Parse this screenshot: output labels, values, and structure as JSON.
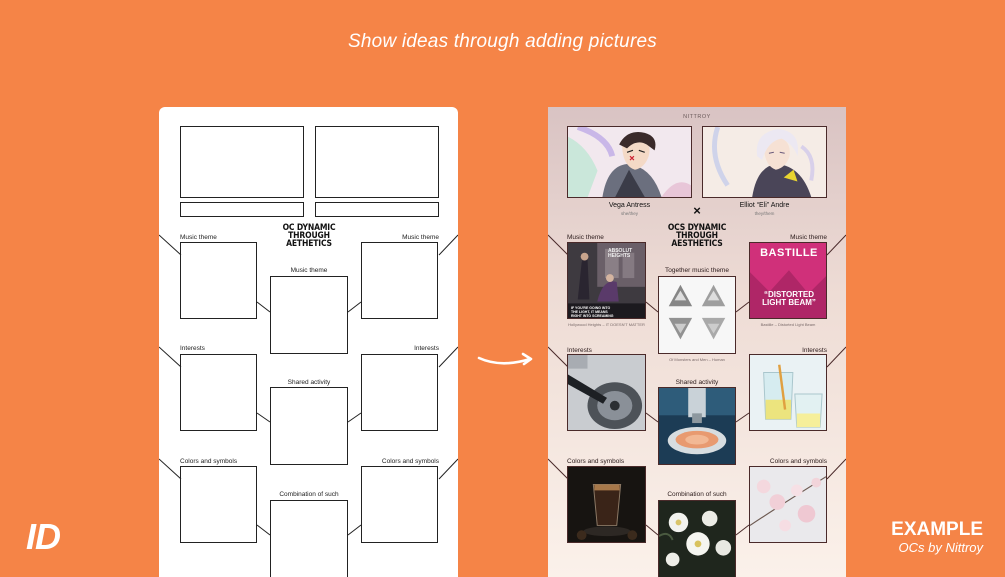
{
  "header": {
    "title": "Show ideas through adding pictures"
  },
  "logo": {
    "text": "ID"
  },
  "example": {
    "title": "EXAMPLE",
    "subtitle": "OCs by Nittroy"
  },
  "template": {
    "title_lines": [
      "OC DYNAMIC",
      "THROUGH",
      "AETHETICS"
    ],
    "music_left": "Music theme",
    "music_right": "Music theme",
    "music_center": "Music theme",
    "interests_left": "Interests",
    "interests_right": "Interests",
    "shared_activity": "Shared activity",
    "colors_left": "Colors and symbols",
    "colors_right": "Colors and symbols",
    "combination": "Combination of such"
  },
  "filled": {
    "author": "NITTROY",
    "char1": {
      "name": "Vega Antress",
      "pronouns": "she/they"
    },
    "char2": {
      "name": "Elliot “Eli” Andre",
      "pronouns": "they/them"
    },
    "cross": "×",
    "title_lines": [
      "OCS DYNAMIC",
      "THROUGH",
      "AESTHETICS"
    ],
    "music_left": "Music theme",
    "music_right": "Music theme",
    "together_music": "Together music theme",
    "interests_left": "Interests",
    "interests_right": "Interests",
    "shared_activity": "Shared activity",
    "colors_left": "Colors and symbols",
    "colors_right": "Colors and symbols",
    "combination": "Combination of such",
    "album_left": {
      "title_lines": [
        "ABSOLUT",
        "HEIGHTS"
      ],
      "text_lines": [
        "IF YOU'RE GOING INTO",
        "THE LIGHT, IT MEANS",
        "RIGHT INTO SCREAMING"
      ],
      "caption": "Hollywood Heights – IT DOESN'T MATTER"
    },
    "album_center": {
      "caption": "Of Monsters and Men – Human"
    },
    "album_right": {
      "band": "BASTILLE",
      "title_lines": [
        "“DISTORTED",
        "LIGHT BEAM”"
      ],
      "caption": "Bastille – Distorted Light Beam"
    }
  },
  "colors": {
    "background": "#F58447",
    "frame": "#4a2a2a",
    "album_right_bg": "#d0307a"
  }
}
